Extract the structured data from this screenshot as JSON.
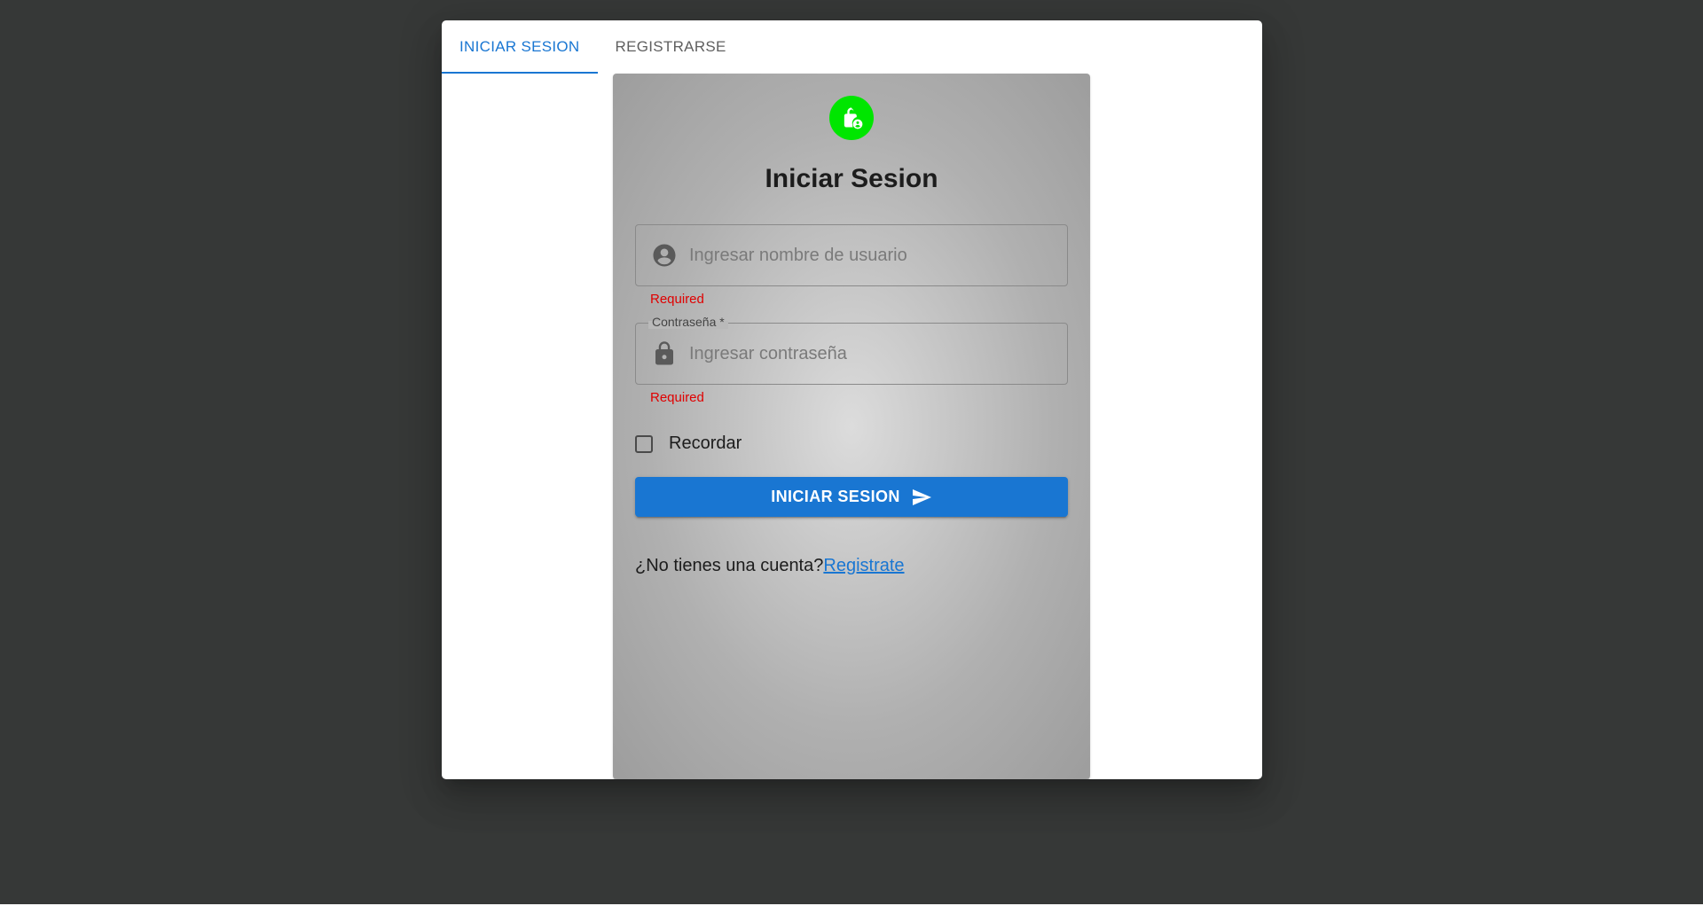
{
  "colors": {
    "primary": "#1976d2",
    "avatar_bg": "#00e600",
    "error": "#e00000",
    "backdrop": "#363837"
  },
  "tabs": [
    {
      "label": "INICIAR SESION",
      "active": true
    },
    {
      "label": "REGISTRARSE",
      "active": false
    }
  ],
  "login_card": {
    "avatar_icon": "lock-person-icon",
    "title": "Iniciar Sesion",
    "username": {
      "icon": "account-circle-icon",
      "placeholder": "Ingresar nombre de usuario",
      "value": "",
      "helper": "Required"
    },
    "password": {
      "icon": "lock-icon",
      "label": "Contraseña *",
      "placeholder": "Ingresar contraseña",
      "value": "",
      "helper": "Required"
    },
    "remember": {
      "label": "Recordar",
      "checked": false
    },
    "submit": {
      "label": "INICIAR SESION",
      "icon": "send-icon"
    },
    "signup_prompt": "¿No tienes una cuenta?",
    "signup_link": "Registrate"
  }
}
